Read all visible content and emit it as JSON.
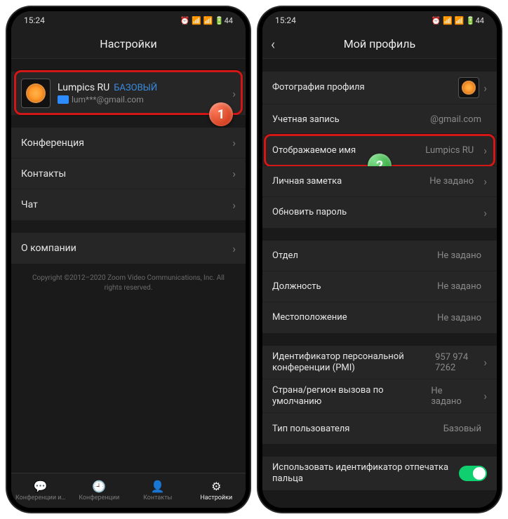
{
  "status": {
    "time": "15:24",
    "icons": "⏰ 📶 📶 🔋44"
  },
  "left": {
    "title": "Настройки",
    "profile": {
      "name": "Lumpics RU",
      "plan": "БАЗОВЫЙ",
      "email": "lum***@gmail.com"
    },
    "items": [
      "Конференция",
      "Контакты",
      "Чат"
    ],
    "about": "О компании",
    "copyright": "Copyright ©2012–2020 Zoom Video Communications, Inc. All rights reserved.",
    "nav": [
      "Конференции и…",
      "Конференции",
      "Контакты",
      "Настройки"
    ]
  },
  "right": {
    "title": "Мой профиль",
    "rows": [
      {
        "label": "Фотография профиля",
        "value": "",
        "avatar": true,
        "chev": true
      },
      {
        "label": "Учетная запись",
        "value": "@gmail.com",
        "chev": false
      },
      {
        "label": "Отображаемое имя",
        "value": "Lumpics RU",
        "chev": true,
        "hl": true
      },
      {
        "label": "Личная заметка",
        "value": "Не задано",
        "chev": true
      },
      {
        "label": "Обновить пароль",
        "value": "",
        "chev": true
      }
    ],
    "rows2": [
      {
        "label": "Отдел",
        "value": "Не задано"
      },
      {
        "label": "Должность",
        "value": "Не задано"
      },
      {
        "label": "Местоположение",
        "value": "Не задано"
      }
    ],
    "rows3": [
      {
        "label": "Идентификатор персональной конференции (PMI)",
        "value": "957 974 7262",
        "chev": true
      },
      {
        "label": "Страна/регион вызова по умолчанию",
        "value": "Не задано",
        "chev": true
      },
      {
        "label": "Тип пользователя",
        "value": "Базовый"
      }
    ],
    "fingerprint": "Использовать идентификатор отпечатка пальца"
  },
  "markers": {
    "m1": "1",
    "m2": "2"
  }
}
